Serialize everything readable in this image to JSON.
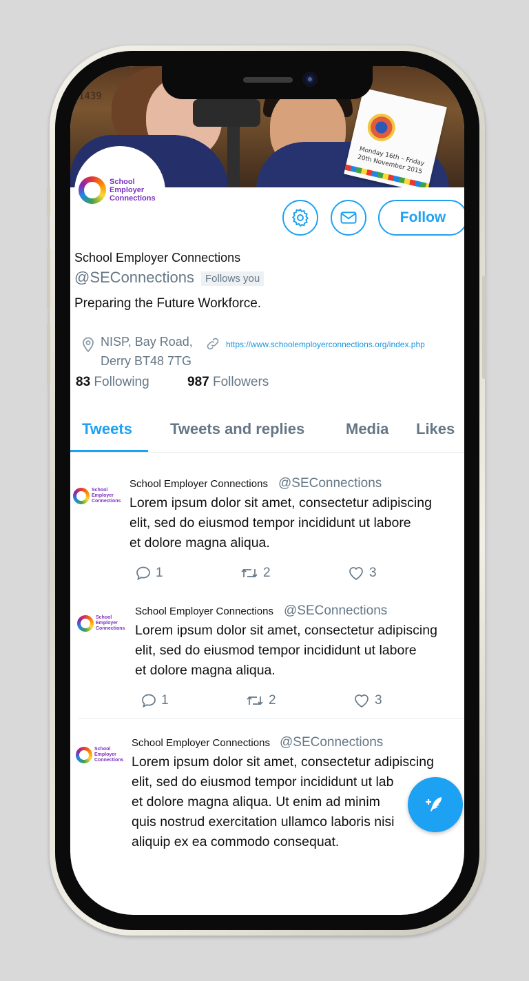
{
  "banner": {
    "wall_number": "1439",
    "flyer_text": "Monday 16th – Friday 20th November 2015"
  },
  "brand": {
    "logo_line1": "School",
    "logo_line2": "Employer",
    "logo_line3": "Connections",
    "accent": "#1da1f2",
    "logo_color": "#7b2fbf"
  },
  "actions": {
    "settings_icon": "gear-icon",
    "message_icon": "mail-icon",
    "follow_label": "Follow"
  },
  "profile": {
    "name": "School Employer Connections",
    "handle": "@SEConnections",
    "follows_you": "Follows you",
    "bio": "Preparing the Future Workforce.",
    "location_line1": "NISP, Bay Road,",
    "location_line2": "Derry BT48 7TG",
    "url": "https://www.schoolemployerconnections.org/index.php",
    "following_count": "83",
    "following_label": "Following",
    "followers_count": "987",
    "followers_label": "Followers"
  },
  "tabs": [
    {
      "label": "Tweets",
      "active": true
    },
    {
      "label": "Tweets and replies",
      "active": false
    },
    {
      "label": "Media",
      "active": false
    },
    {
      "label": "Likes",
      "active": false
    }
  ],
  "tweets": [
    {
      "author": "School Employer Connections",
      "handle": "@SEConnections",
      "line1": "Lorem ipsum dolor sit amet, consectetur adipiscing",
      "line2": "elit, sed do eiusmod tempor incididunt ut labore",
      "line3": "et dolore magna aliqua.",
      "replies": "1",
      "retweets": "2",
      "likes": "3"
    },
    {
      "author": "School Employer Connections",
      "handle": "@SEConnections",
      "line1": "Lorem ipsum dolor sit amet, consectetur adipiscing",
      "line2": "elit, sed do eiusmod tempor incididunt ut labore",
      "line3": "et dolore magna aliqua.",
      "replies": "1",
      "retweets": "2",
      "likes": "3"
    },
    {
      "author": "School Employer Connections",
      "handle": "@SEConnections",
      "line1": "Lorem ipsum dolor sit amet, consectetur adipiscing",
      "line2": "elit, sed do eiusmod tempor incididunt ut lab",
      "line3": "et dolore magna aliqua. Ut enim ad minim",
      "line4": "quis nostrud exercitation ullamco laboris nisi",
      "line5": "aliquip ex ea commodo consequat."
    }
  ],
  "fab_icon": "compose-tweet-icon"
}
